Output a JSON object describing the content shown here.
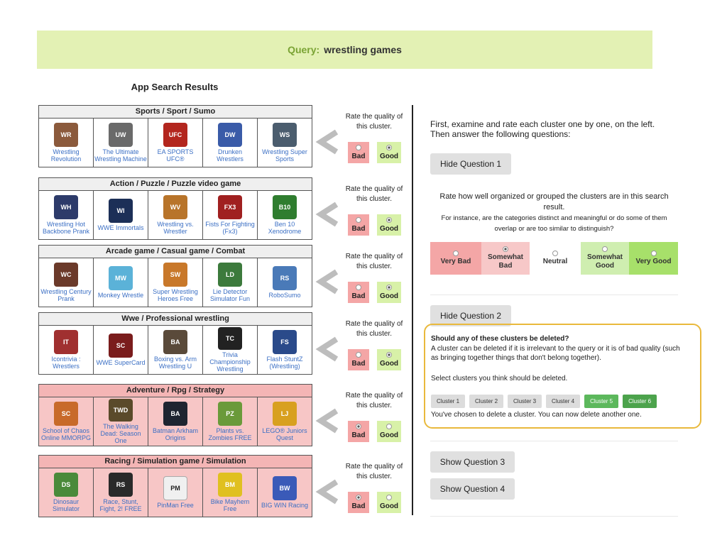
{
  "query": {
    "label": "Query:",
    "text": "wrestling games"
  },
  "results_title": "App Search Results",
  "rate_prompt": "Rate the quality of this cluster.",
  "rate_bad": "Bad",
  "rate_good": "Good",
  "clusters": [
    {
      "title": "Sports / Sport / Sumo",
      "deleted": false,
      "rating": "good",
      "apps": [
        {
          "name": "Wrestling Revolution",
          "color": "#8b5a3c",
          "glyph": "WR"
        },
        {
          "name": "The Ultimate Wrestling Machine",
          "color": "#6a6a6a",
          "glyph": "UW"
        },
        {
          "name": "EA SPORTS UFC®",
          "color": "#b3261e",
          "glyph": "UFC"
        },
        {
          "name": "Drunken Wrestlers",
          "color": "#3a5ba8",
          "glyph": "DW"
        },
        {
          "name": "Wrestling Super Sports",
          "color": "#4b5d6e",
          "glyph": "WS"
        }
      ]
    },
    {
      "title": "Action / Puzzle / Puzzle video game",
      "deleted": false,
      "rating": "good",
      "apps": [
        {
          "name": "Wrestling Hot Backbone Prank",
          "color": "#2d3b6a",
          "glyph": "WH"
        },
        {
          "name": "WWE Immortals",
          "color": "#1c2f57",
          "glyph": "WI"
        },
        {
          "name": "Wrestling vs. Wrestler",
          "color": "#b8742a",
          "glyph": "WV"
        },
        {
          "name": "Fists For Fighting (Fx3)",
          "color": "#a02020",
          "glyph": "FX3"
        },
        {
          "name": "Ben 10 Xenodrome",
          "color": "#2f7d2f",
          "glyph": "B10"
        }
      ]
    },
    {
      "title": "Arcade game / Casual game / Combat",
      "deleted": false,
      "rating": "good",
      "apps": [
        {
          "name": "Wrestling Century Prank",
          "color": "#6b3a2a",
          "glyph": "WC"
        },
        {
          "name": "Monkey Wrestle",
          "color": "#5bb2d8",
          "glyph": "MW"
        },
        {
          "name": "Super Wrestling Heroes Free",
          "color": "#c8782a",
          "glyph": "SW"
        },
        {
          "name": "Lie Detector Simulator Fun",
          "color": "#3c7a3c",
          "glyph": "LD"
        },
        {
          "name": "RoboSumo",
          "color": "#4a7ab8",
          "glyph": "RS"
        }
      ]
    },
    {
      "title": "Wwe / Professional wrestling",
      "deleted": false,
      "rating": "good",
      "apps": [
        {
          "name": "Icontrivia : Wrestlers",
          "color": "#a03030",
          "glyph": "IT"
        },
        {
          "name": "WWE SuperCard",
          "color": "#7a1c1c",
          "glyph": "SC"
        },
        {
          "name": "Boxing vs. Arm Wrestling U",
          "color": "#5a4a3a",
          "glyph": "BA"
        },
        {
          "name": "Trivia Championship Wrestling",
          "color": "#222222",
          "glyph": "TC"
        },
        {
          "name": "Flash StuntZ (Wrestling)",
          "color": "#2a4a8a",
          "glyph": "FS"
        }
      ]
    },
    {
      "title": "Adventure / Rpg / Strategy",
      "deleted": true,
      "rating": "bad",
      "apps": [
        {
          "name": "School of Chaos Online MMORPG",
          "color": "#c86a2a",
          "glyph": "SC"
        },
        {
          "name": "The Walking Dead: Season One",
          "color": "#5a4a2a",
          "glyph": "TWD"
        },
        {
          "name": "Batman Arkham Origins",
          "color": "#1e2430",
          "glyph": "BA"
        },
        {
          "name": "Plants vs. Zombies FREE",
          "color": "#6a9a3a",
          "glyph": "PZ"
        },
        {
          "name": "LEGO® Juniors Quest",
          "color": "#d8a020",
          "glyph": "LJ"
        }
      ]
    },
    {
      "title": "Racing / Simulation game / Simulation",
      "deleted": true,
      "rating": "bad",
      "apps": [
        {
          "name": "Dinosaur Simulator",
          "color": "#4a8a3a",
          "glyph": "DS"
        },
        {
          "name": "Race, Stunt, Fight, 2! FREE",
          "color": "#2a2a2a",
          "glyph": "RS"
        },
        {
          "name": "PinMan Free",
          "color": "#f0f0f0",
          "glyph": "PM"
        },
        {
          "name": "Bike Mayhem Free",
          "color": "#e0c020",
          "glyph": "BM"
        },
        {
          "name": "BIG WIN Racing",
          "color": "#3a5ab8",
          "glyph": "BW"
        }
      ]
    }
  ],
  "intro": "First, examine and rate each cluster one by one, on the left. Then answer the following questions:",
  "q1": {
    "hide_label": "Hide Question 1",
    "question": "Rate how well organized or grouped the clusters are in this search result.",
    "hint": "For instance, are the categories distinct and meaningful or do some of them overlap or are too similar to distinguish?",
    "options": [
      {
        "label": "Very Bad",
        "color": "#f4a6a6",
        "selected": false
      },
      {
        "label": "Somewhat Bad",
        "color": "#f7c8c8",
        "selected": true
      },
      {
        "label": "Neutral",
        "color": "#ffffff",
        "selected": false
      },
      {
        "label": "Somewhat Good",
        "color": "#cfeeb0",
        "selected": false
      },
      {
        "label": "Very Good",
        "color": "#a7e06a",
        "selected": false
      }
    ]
  },
  "q2": {
    "hide_label": "Hide Question 2",
    "title": "Should any of these clusters be deleted?",
    "desc": "A cluster can be deleted if it is irrelevant to the query or it is of bad quality (such as bringing together things that don't belong together).",
    "select_prompt": "Select clusters you think should be deleted.",
    "clusters": [
      {
        "label": "Cluster 1",
        "state": "off"
      },
      {
        "label": "Cluster 2",
        "state": "off"
      },
      {
        "label": "Cluster 3",
        "state": "off"
      },
      {
        "label": "Cluster 4",
        "state": "off"
      },
      {
        "label": "Cluster 5",
        "state": "on"
      },
      {
        "label": "Cluster 6",
        "state": "on2"
      }
    ],
    "note": "You've chosen to delete a cluster. You can now delete another one."
  },
  "q3": {
    "show_label": "Show Question 3"
  },
  "q4": {
    "show_label": "Show Question 4"
  }
}
